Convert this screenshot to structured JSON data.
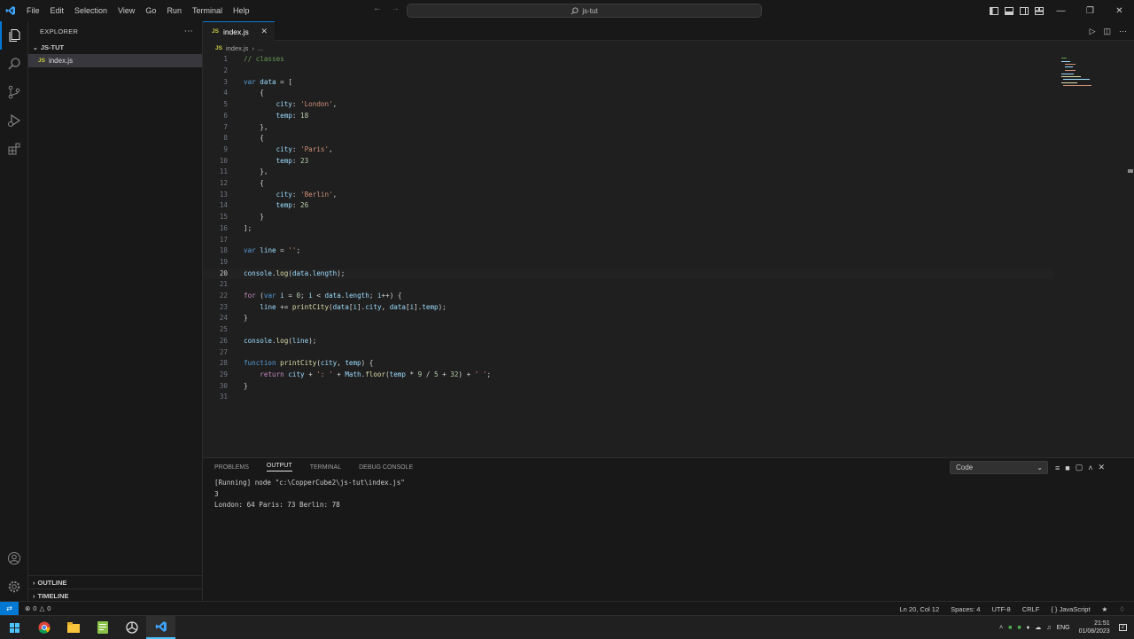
{
  "menu": [
    "File",
    "Edit",
    "Selection",
    "View",
    "Go",
    "Run",
    "Terminal",
    "Help"
  ],
  "command_center": "js-tut",
  "sidebar": {
    "title": "EXPLORER",
    "folder": "JS-TUT",
    "file_badge": "JS",
    "file": "index.js",
    "outline": "OUTLINE",
    "timeline": "TIMELINE"
  },
  "tab": {
    "badge": "JS",
    "label": "index.js"
  },
  "breadcrumb": {
    "file": "index.js",
    "rest": "..."
  },
  "editor": {
    "current_line": 20,
    "lines": [
      "// classes",
      "",
      "var data = [",
      "    {",
      "        city: 'London',",
      "        temp: 18",
      "    },",
      "    {",
      "        city: 'Paris',",
      "        temp: 23",
      "    },",
      "    {",
      "        city: 'Berlin',",
      "        temp: 26",
      "    }",
      "];",
      "",
      "var line = '';",
      "",
      "console.log(data.length);",
      "",
      "for (var i = 0; i < data.length; i++) {",
      "    line += printCity(data[i].city, data[i].temp);",
      "}",
      "",
      "console.log(line);",
      "",
      "function printCity(city, temp) {",
      "    return city + ': ' + Math.floor(temp * 9 / 5 + 32) + ' ';",
      "}",
      ""
    ]
  },
  "panel": {
    "tabs": [
      "PROBLEMS",
      "OUTPUT",
      "TERMINAL",
      "DEBUG CONSOLE"
    ],
    "active_tab": "OUTPUT",
    "channel": "Code",
    "output": [
      "[Running] node \"c:\\CopperCube2\\js-tut\\index.js\"",
      "3",
      "London: 64 Paris: 73 Berlin: 78"
    ]
  },
  "status": {
    "errors": "0",
    "warnings": "0",
    "position": "Ln 20, Col 12",
    "spaces": "Spaces: 4",
    "encoding": "UTF-8",
    "eol": "CRLF",
    "language": "JavaScript"
  },
  "taskbar": {
    "lang": "ENG",
    "time": "21:51",
    "date": "01/08/2023",
    "notifications": "2"
  },
  "colors": {
    "accent": "#0078d4",
    "editor_bg": "#1f1f1f",
    "sidebar_bg": "#181818"
  }
}
